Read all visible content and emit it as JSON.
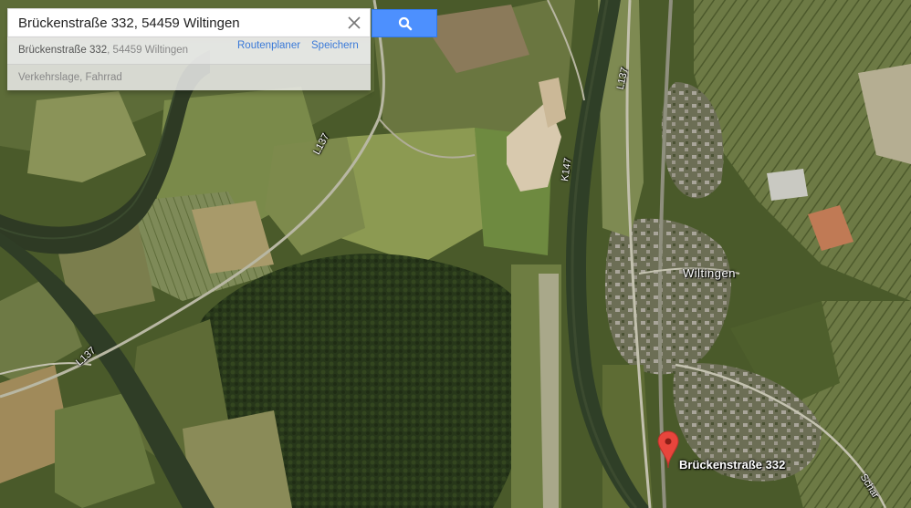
{
  "search": {
    "query": "Brückenstraße 332, 54459 Wiltingen",
    "button_icon": "search-icon",
    "clear_icon": "close-icon"
  },
  "suggestions": [
    {
      "main": "Brückenstraße 332",
      "secondary": ", 54459 Wiltingen",
      "actions": [
        "Routenplaner",
        "Speichern"
      ]
    },
    {
      "main": "Verkehrslage, Fahrrad"
    }
  ],
  "map": {
    "type": "satellite",
    "place_label": "Wiltingen",
    "road_labels": [
      "L137",
      "L137",
      "L137",
      "K147",
      "L137"
    ],
    "partial_road_label": "Schar",
    "marker": {
      "label": "Brückenstraße 332",
      "icon": "map-pin-icon",
      "color": "#e8453c"
    }
  },
  "colors": {
    "search_button": "#4d90fe",
    "link": "#3a79d8"
  }
}
